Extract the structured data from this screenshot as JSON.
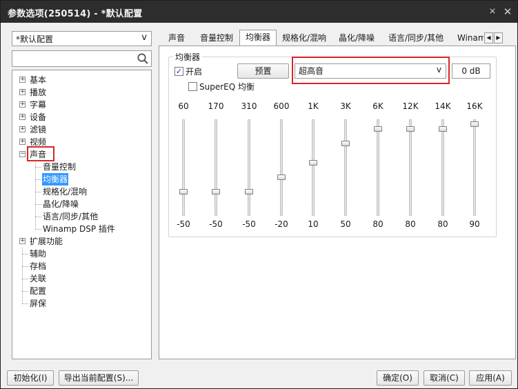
{
  "window": {
    "title": "参数选项(250514) - *默认配置"
  },
  "sidebar": {
    "profile": "*默认配置",
    "search_placeholder": "",
    "tree": [
      {
        "label": "基本",
        "expandable": true
      },
      {
        "label": "播放",
        "expandable": true
      },
      {
        "label": "字幕",
        "expandable": true
      },
      {
        "label": "设备",
        "expandable": true
      },
      {
        "label": "滤镜",
        "expandable": true
      },
      {
        "label": "视频",
        "expandable": true
      },
      {
        "label": "声音",
        "expandable": true,
        "expanded": true,
        "highlighted": true
      },
      {
        "label": "音量控制",
        "child": true
      },
      {
        "label": "均衡器",
        "child": true,
        "selected": true
      },
      {
        "label": "规格化/混响",
        "child": true
      },
      {
        "label": "晶化/降噪",
        "child": true
      },
      {
        "label": "语言/同步/其他",
        "child": true
      },
      {
        "label": "Winamp DSP 插件",
        "child": true
      },
      {
        "label": "扩展功能",
        "expandable": true
      },
      {
        "label": "辅助"
      },
      {
        "label": "存档"
      },
      {
        "label": "关联"
      },
      {
        "label": "配置"
      },
      {
        "label": "屏保"
      }
    ]
  },
  "tabs": [
    "声音",
    "音量控制",
    "均衡器",
    "规格化/混响",
    "晶化/降噪",
    "语言/同步/其他",
    "Winam"
  ],
  "active_tab": "均衡器",
  "equalizer": {
    "group_title": "均衡器",
    "enable_label": "开启",
    "enable_checked": true,
    "preset_button": "预置",
    "preset_value": "超高音",
    "gain_label": "0 dB",
    "supereq_label": "SuperEQ 均衡",
    "supereq_checked": false,
    "bands": [
      {
        "freq": "60",
        "value": -50
      },
      {
        "freq": "170",
        "value": -50
      },
      {
        "freq": "310",
        "value": -50
      },
      {
        "freq": "600",
        "value": -20
      },
      {
        "freq": "1K",
        "value": 10
      },
      {
        "freq": "3K",
        "value": 50
      },
      {
        "freq": "6K",
        "value": 80
      },
      {
        "freq": "12K",
        "value": 80
      },
      {
        "freq": "14K",
        "value": 80
      },
      {
        "freq": "16K",
        "value": 90
      }
    ]
  },
  "footer": {
    "init": "初始化(I)",
    "export": "导出当前配置(S)...",
    "ok": "确定(O)",
    "cancel": "取消(C)",
    "apply": "应用(A)"
  },
  "colors": {
    "highlight": "#d9232a",
    "selection": "#3399ff",
    "titlebar": "#2d2d2d"
  }
}
